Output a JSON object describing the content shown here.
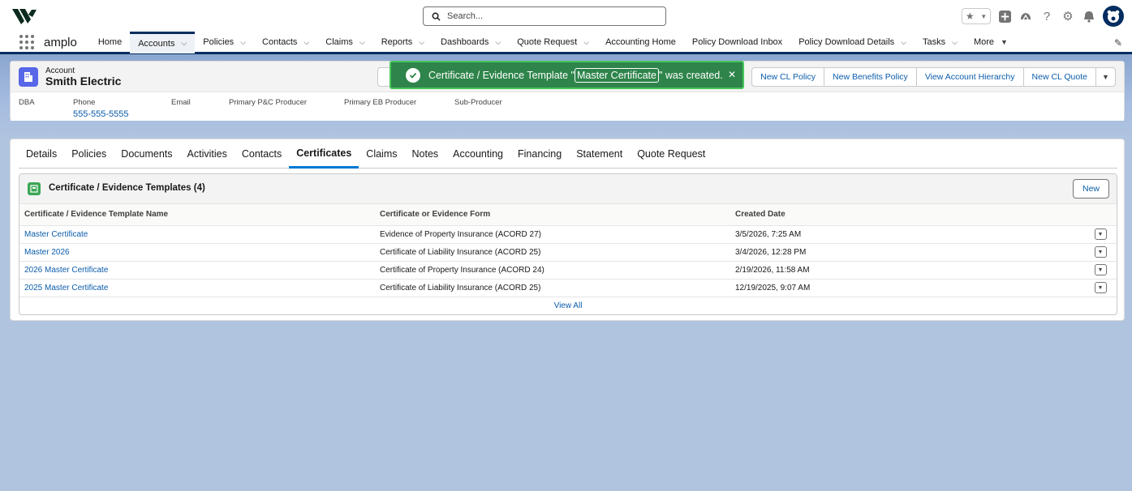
{
  "header": {
    "search_placeholder": "Search...",
    "icons": [
      "favorites-star-icon",
      "add-icon",
      "trailhead-icon",
      "help-icon",
      "setup-gear-icon",
      "notifications-bell-icon",
      "user-avatar"
    ]
  },
  "nav": {
    "app_name": "amplo",
    "items": [
      {
        "label": "Home",
        "chevron": false
      },
      {
        "label": "Accounts",
        "chevron": true,
        "active": true
      },
      {
        "label": "Policies",
        "chevron": true
      },
      {
        "label": "Contacts",
        "chevron": true
      },
      {
        "label": "Claims",
        "chevron": true
      },
      {
        "label": "Reports",
        "chevron": true
      },
      {
        "label": "Dashboards",
        "chevron": true
      },
      {
        "label": "Quote Request",
        "chevron": true
      },
      {
        "label": "Accounting Home",
        "chevron": false
      },
      {
        "label": "Policy Download Inbox",
        "chevron": false
      },
      {
        "label": "Policy Download Details",
        "chevron": true
      },
      {
        "label": "Tasks",
        "chevron": true
      },
      {
        "label": "More",
        "chevron": true
      }
    ]
  },
  "record": {
    "object_label": "Account",
    "name": "Smith Electric",
    "actions": [
      "New CL Policy",
      "New Benefits Policy",
      "View Account Hierarchy",
      "New CL Quote"
    ],
    "fields": [
      {
        "label": "DBA",
        "value": ""
      },
      {
        "label": "Phone",
        "value": "555-555-5555"
      },
      {
        "label": "Email",
        "value": ""
      },
      {
        "label": "Primary P&C Producer",
        "value": ""
      },
      {
        "label": "Primary EB Producer",
        "value": ""
      },
      {
        "label": "Sub-Producer",
        "value": ""
      }
    ]
  },
  "toast": {
    "prefix": "Certificate / Evidence Template \"",
    "link": "Master Certificate",
    "suffix": "\" was created."
  },
  "tabs": [
    "Details",
    "Policies",
    "Documents",
    "Activities",
    "Contacts",
    "Certificates",
    "Claims",
    "Notes",
    "Accounting",
    "Financing",
    "Statement",
    "Quote Request"
  ],
  "active_tab": "Certificates",
  "related_list": {
    "title": "Certificate / Evidence Templates (4)",
    "new_label": "New",
    "columns": [
      "Certificate / Evidence Template Name",
      "Certificate or Evidence Form",
      "Created Date"
    ],
    "rows": [
      {
        "name": "Master Certificate",
        "form": "Evidence of Property Insurance (ACORD 27)",
        "created": "3/5/2026, 7:25 AM"
      },
      {
        "name": "Master 2026",
        "form": "Certificate of Liability Insurance (ACORD 25)",
        "created": "3/4/2026, 12:28 PM"
      },
      {
        "name": "2026 Master Certificate",
        "form": "Certificate of Property Insurance (ACORD 24)",
        "created": "2/19/2026, 11:58 AM"
      },
      {
        "name": "2025 Master Certificate",
        "form": "Certificate of Liability Insurance (ACORD 25)",
        "created": "12/19/2025, 9:07 AM"
      }
    ],
    "view_all": "View All"
  }
}
